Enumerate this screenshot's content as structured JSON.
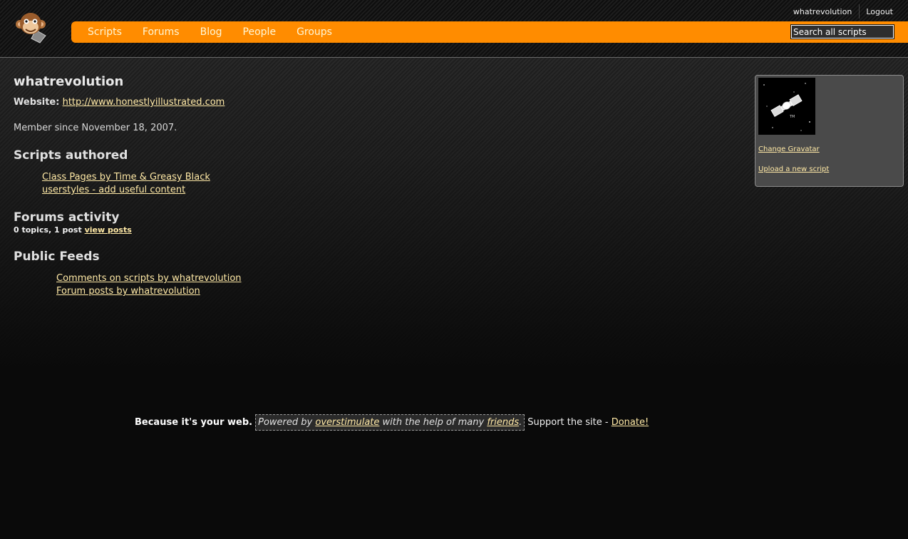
{
  "header": {
    "logo_icon": "monkey-logo-icon",
    "topnav": {
      "user": "whatrevolution",
      "logout": "Logout"
    },
    "nav": [
      {
        "label": "Scripts"
      },
      {
        "label": "Forums"
      },
      {
        "label": "Blog"
      },
      {
        "label": "People"
      },
      {
        "label": "Groups"
      }
    ],
    "search": {
      "placeholder": "Search all scripts"
    },
    "accent_color": "#ff8c00"
  },
  "profile": {
    "username": "whatrevolution",
    "website_label": "Website:",
    "website_url": "http://www.honestlyillustrated.com",
    "member_since": "Member since November 18, 2007."
  },
  "scripts_section": {
    "heading": "Scripts authored",
    "items": [
      {
        "label": "Class Pages by Time & Greasy Black"
      },
      {
        "label": "userstyles - add useful content"
      }
    ]
  },
  "forums_section": {
    "heading": "Forums activity",
    "summary": "0 topics, 1 post",
    "link": "view posts"
  },
  "feeds_section": {
    "heading": "Public Feeds",
    "items": [
      {
        "label": "Comments on scripts by whatrevolution"
      },
      {
        "label": "Forum posts by whatrevolution"
      }
    ]
  },
  "sidebar": {
    "gravatar_icon": "satellite-gravatar-icon",
    "change_gravatar": "Change Gravatar",
    "upload_script": "Upload a new script"
  },
  "footer": {
    "tagline": "Because it's your web.",
    "powered_prefix": "Powered by ",
    "powered_link": "overstimulate",
    "powered_middle": " with the help of many ",
    "friends_link": "friends",
    "powered_suffix": ".",
    "support_text": "Support the site - ",
    "donate_link": "Donate!"
  }
}
